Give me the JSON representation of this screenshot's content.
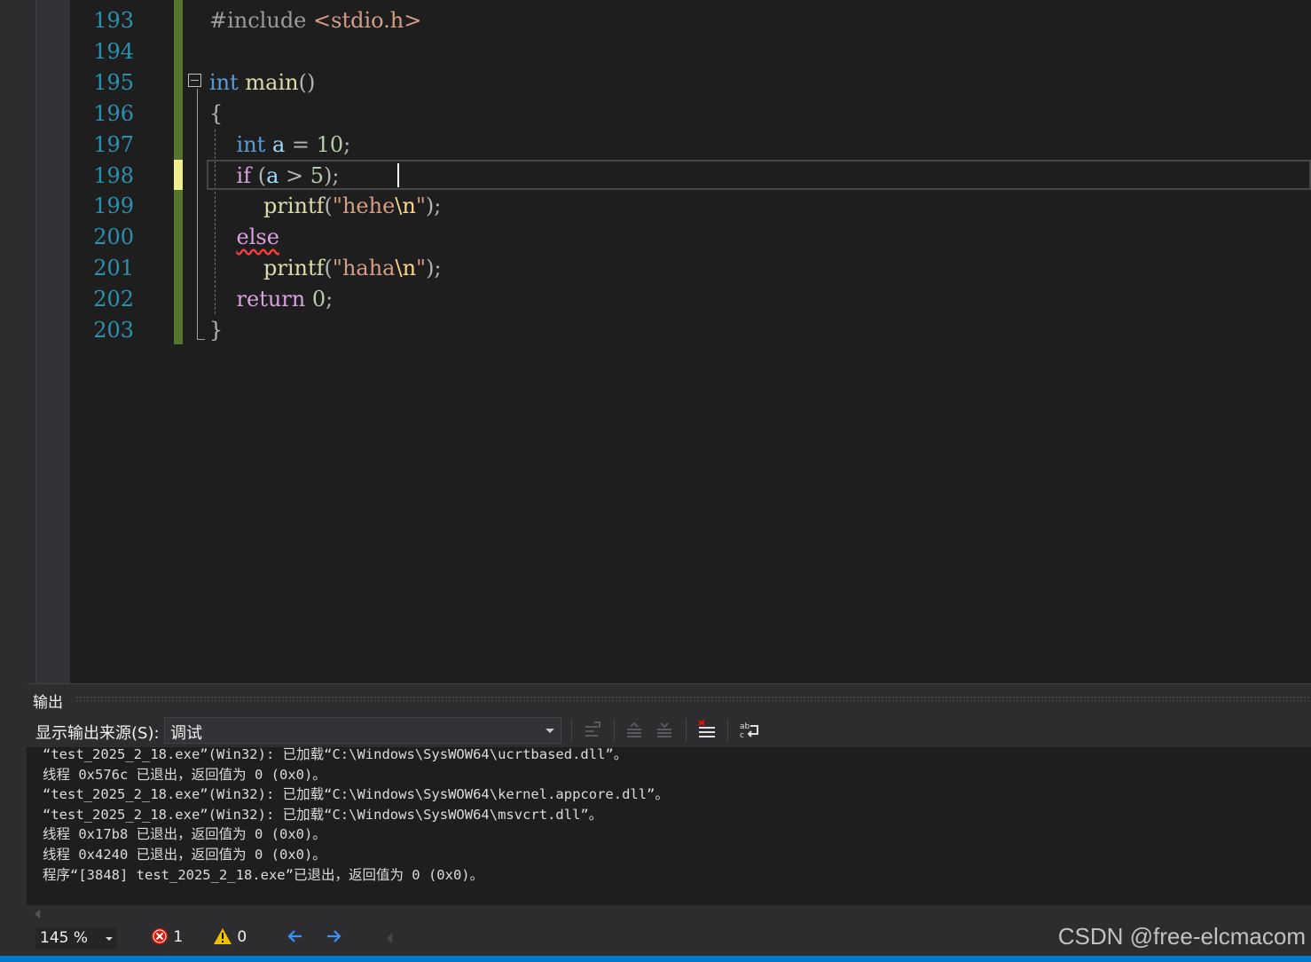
{
  "editor": {
    "lines": [
      {
        "number": "193",
        "tokens": [
          [
            "pre",
            "#include "
          ],
          [
            "inc",
            "<stdio.h>"
          ]
        ]
      },
      {
        "number": "194",
        "tokens": []
      },
      {
        "number": "195",
        "tokens": [
          [
            "kw",
            "int"
          ],
          [
            "",
            " "
          ],
          [
            "fn",
            "main"
          ],
          [
            "punc",
            "()"
          ]
        ]
      },
      {
        "number": "196",
        "tokens": [
          [
            "punc",
            "{"
          ]
        ]
      },
      {
        "number": "197",
        "tokens": [
          [
            "",
            "    "
          ],
          [
            "kw",
            "int"
          ],
          [
            "",
            " "
          ],
          [
            "var",
            "a"
          ],
          [
            "punc",
            " = "
          ],
          [
            "num",
            "10"
          ],
          [
            "punc",
            ";"
          ]
        ]
      },
      {
        "number": "198",
        "tokens": [
          [
            "",
            "    "
          ],
          [
            "ctl",
            "if"
          ],
          [
            "punc",
            " ("
          ],
          [
            "var",
            "a"
          ],
          [
            "punc",
            " > "
          ],
          [
            "num",
            "5"
          ],
          [
            "punc",
            ");"
          ]
        ]
      },
      {
        "number": "199",
        "tokens": [
          [
            "",
            "        "
          ],
          [
            "fn",
            "printf"
          ],
          [
            "punc",
            "("
          ],
          [
            "str",
            "\"hehe"
          ],
          [
            "esc",
            "\\n"
          ],
          [
            "str",
            "\""
          ],
          [
            "punc",
            ");"
          ]
        ]
      },
      {
        "number": "200",
        "tokens": [
          [
            "",
            "    "
          ],
          [
            "ctl squiggle",
            "else"
          ]
        ]
      },
      {
        "number": "201",
        "tokens": [
          [
            "",
            "        "
          ],
          [
            "fn",
            "printf"
          ],
          [
            "punc",
            "("
          ],
          [
            "str",
            "\"haha"
          ],
          [
            "esc",
            "\\n"
          ],
          [
            "str",
            "\""
          ],
          [
            "punc",
            ");"
          ]
        ]
      },
      {
        "number": "202",
        "tokens": [
          [
            "",
            "    "
          ],
          [
            "ctl",
            "return"
          ],
          [
            "",
            " "
          ],
          [
            "num",
            "0"
          ],
          [
            "punc",
            ";"
          ]
        ]
      },
      {
        "number": "203",
        "tokens": [
          [
            "punc",
            "}"
          ]
        ]
      }
    ]
  },
  "output": {
    "title": "输出",
    "source_label": "显示输出来源(S):",
    "source_value": "调试",
    "lines": [
      "“test_2025_2_18.exe”(Win32): 已加载“C:\\Windows\\SysWOW64\\ucrtbased.dll”。",
      "线程 0x576c 已退出，返回值为 0 (0x0)。",
      "“test_2025_2_18.exe”(Win32): 已加载“C:\\Windows\\SysWOW64\\kernel.appcore.dll”。",
      "“test_2025_2_18.exe”(Win32): 已加载“C:\\Windows\\SysWOW64\\msvcrt.dll”。",
      "线程 0x17b8 已退出，返回值为 0 (0x0)。",
      "线程 0x4240 已退出，返回值为 0 (0x0)。",
      "程序“[3848] test_2025_2_18.exe”已退出，返回值为 0 (0x0)。"
    ]
  },
  "status": {
    "zoom": "145 %",
    "errors": "1",
    "warnings": "0"
  },
  "watermark": "CSDN @free-elcmacom"
}
